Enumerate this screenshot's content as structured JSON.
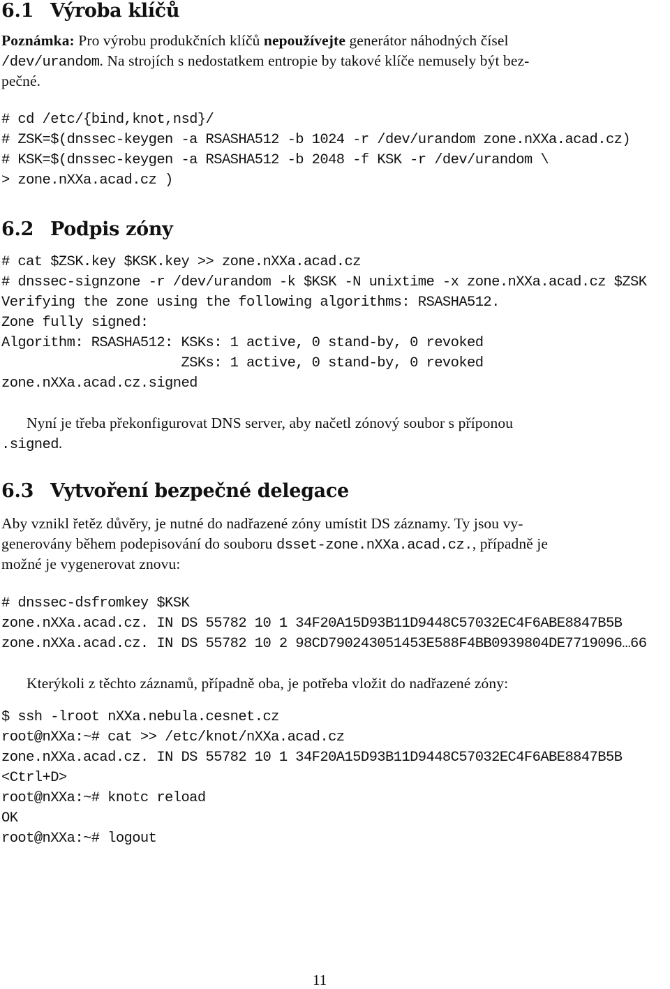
{
  "sections": [
    {
      "number": "6.1",
      "title": "Výroba klíčů",
      "note": {
        "label": "Poznámka:",
        "text_before": " Pro výrobu produkčních klíčů ",
        "emphasis": "nepoužívejte",
        "text_after": " generátor náhodných čísel",
        "line2_code": "/dev/urandom",
        "line2_text": ". Na strojích s nedostatkem entropie by takové klíče nemusely být bez-",
        "line3_text": "pečné."
      },
      "code": [
        "# cd /etc/{bind,knot,nsd}/",
        "# ZSK=$(dnssec-keygen -a RSASHA512 -b 1024 -r /dev/urandom zone.nXXa.acad.cz)",
        "# KSK=$(dnssec-keygen -a RSASHA512 -b 2048 -f KSK -r /dev/urandom \\",
        "> zone.nXXa.acad.cz )"
      ]
    },
    {
      "number": "6.2",
      "title": "Podpis zóny",
      "code": [
        "# cat $ZSK.key $KSK.key >> zone.nXXa.acad.cz",
        "# dnssec-signzone -r /dev/urandom -k $KSK -N unixtime -x zone.nXXa.acad.cz $ZSK",
        "Verifying the zone using the following algorithms: RSASHA512.",
        "Zone fully signed:",
        "Algorithm: RSASHA512: KSKs: 1 active, 0 stand-by, 0 revoked",
        "                      ZSKs: 1 active, 0 stand-by, 0 revoked",
        "zone.nXXa.acad.cz.signed"
      ],
      "paragraph": {
        "line1": "Nyní je třeba překonfigurovat DNS server, aby načetl zónový soubor s příponou",
        "line2_code": ".signed",
        "line2_text": "."
      }
    },
    {
      "number": "6.3",
      "title": "Vytvoření bezpečné delegace",
      "paragraph": {
        "line1": "Aby vznikl řetěz důvěry, je nutné do nadřazené zóny umístit DS záznamy. Ty jsou vy-",
        "line2_before": "generovány během podepisování do souboru ",
        "line2_code": "dsset-zone.nXXa.acad.cz.",
        "line2_after": ", případně je",
        "line3": "možné je vygenerovat znovu:"
      },
      "code1": [
        "# dnssec-dsfromkey $KSK",
        "zone.nXXa.acad.cz. IN DS 55782 10 1 34F20A15D93B11D9448C57032EC4F6ABE8847B5B",
        "zone.nXXa.acad.cz. IN DS 55782 10 2 98CD790243051453E588F4BB0939804DE7719096…66"
      ],
      "paragraph2": "Kterýkoli z těchto záznamů, případně oba, je potřeba vložit do nadřazené zóny:",
      "code2": [
        "$ ssh -lroot nXXa.nebula.cesnet.cz",
        "root@nXXa:~# cat >> /etc/knot/nXXa.acad.cz",
        "zone.nXXa.acad.cz. IN DS 55782 10 1 34F20A15D93B11D9448C57032EC4F6ABE8847B5B",
        "<Ctrl+D>",
        "root@nXXa:~# knotc reload",
        "OK",
        "root@nXXa:~# logout"
      ]
    }
  ],
  "page_number": "11"
}
